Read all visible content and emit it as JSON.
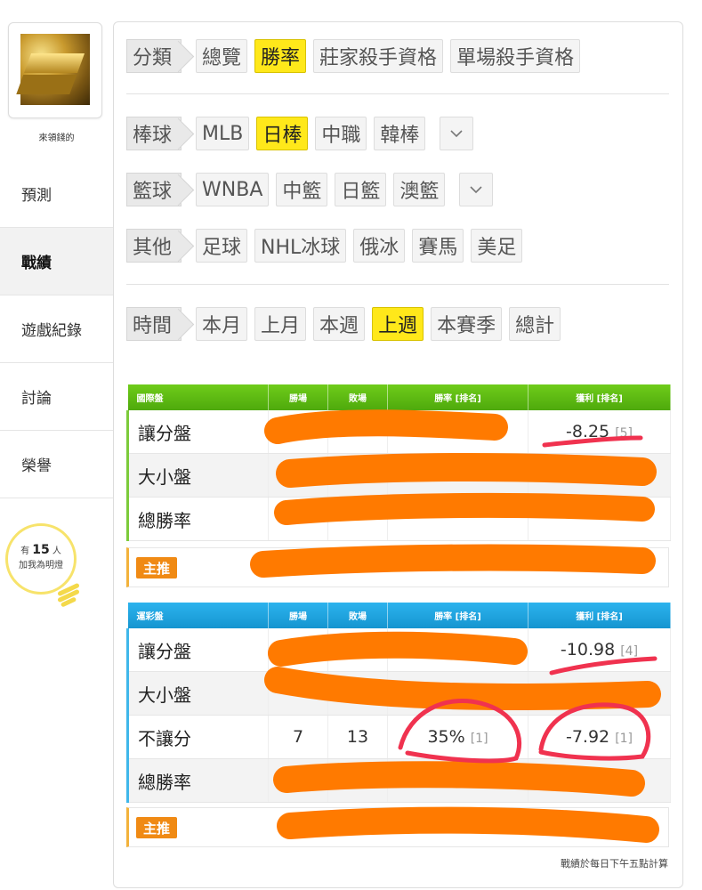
{
  "sidebar": {
    "username": "來領錢的",
    "nav": [
      "預測",
      "戰績",
      "遊戲紀錄",
      "討論",
      "榮譽"
    ],
    "active_index": 1,
    "fans": {
      "prefix": "有",
      "count": "15",
      "suffix": "人",
      "caption": "加我為明燈"
    }
  },
  "filters": {
    "category": {
      "label": "分類",
      "options": [
        "總覽",
        "勝率",
        "莊家殺手資格",
        "單場殺手資格"
      ],
      "selected": "勝率"
    },
    "baseball": {
      "label": "棒球",
      "options": [
        "MLB",
        "日棒",
        "中職",
        "韓棒"
      ],
      "selected": "日棒"
    },
    "basketball": {
      "label": "籃球",
      "options": [
        "WNBA",
        "中籃",
        "日籃",
        "澳籃"
      ]
    },
    "other": {
      "label": "其他",
      "options": [
        "足球",
        "NHL冰球",
        "俄冰",
        "賽馬",
        "美足"
      ]
    },
    "time": {
      "label": "時間",
      "options": [
        "本月",
        "上月",
        "本週",
        "上週",
        "本賽季",
        "總計"
      ],
      "selected": "上週"
    }
  },
  "intl_table": {
    "headers": [
      "國際盤",
      "勝場",
      "敗場",
      "勝率 [排名]",
      "獲利 [排名]"
    ],
    "rows": [
      {
        "label": "讓分盤",
        "profit": "-8.25",
        "profit_rank": "[5]"
      },
      {
        "label": "大小盤"
      },
      {
        "label": "總勝率"
      }
    ],
    "main_push": "主推"
  },
  "lottery_table": {
    "headers": [
      "運彩盤",
      "勝場",
      "敗場",
      "勝率 [排名]",
      "獲利 [排名]"
    ],
    "rows": [
      {
        "label": "讓分盤",
        "profit": "-10.98",
        "profit_rank": "[4]"
      },
      {
        "label": "大小盤"
      },
      {
        "label": "不讓分",
        "wins": "7",
        "losses": "13",
        "rate": "35%",
        "rate_rank": "[1]",
        "profit": "-7.92",
        "profit_rank": "[1]"
      },
      {
        "label": "總勝率"
      }
    ],
    "main_push": "主推"
  },
  "footnote": "戰績於每日下午五點計算",
  "colors": {
    "selected": "#ffe81a",
    "intl_header": "#5cb814",
    "lottery_header": "#1ea4dd",
    "scribble_orange": "#ff7a00",
    "scribble_red": "#f0324f"
  }
}
